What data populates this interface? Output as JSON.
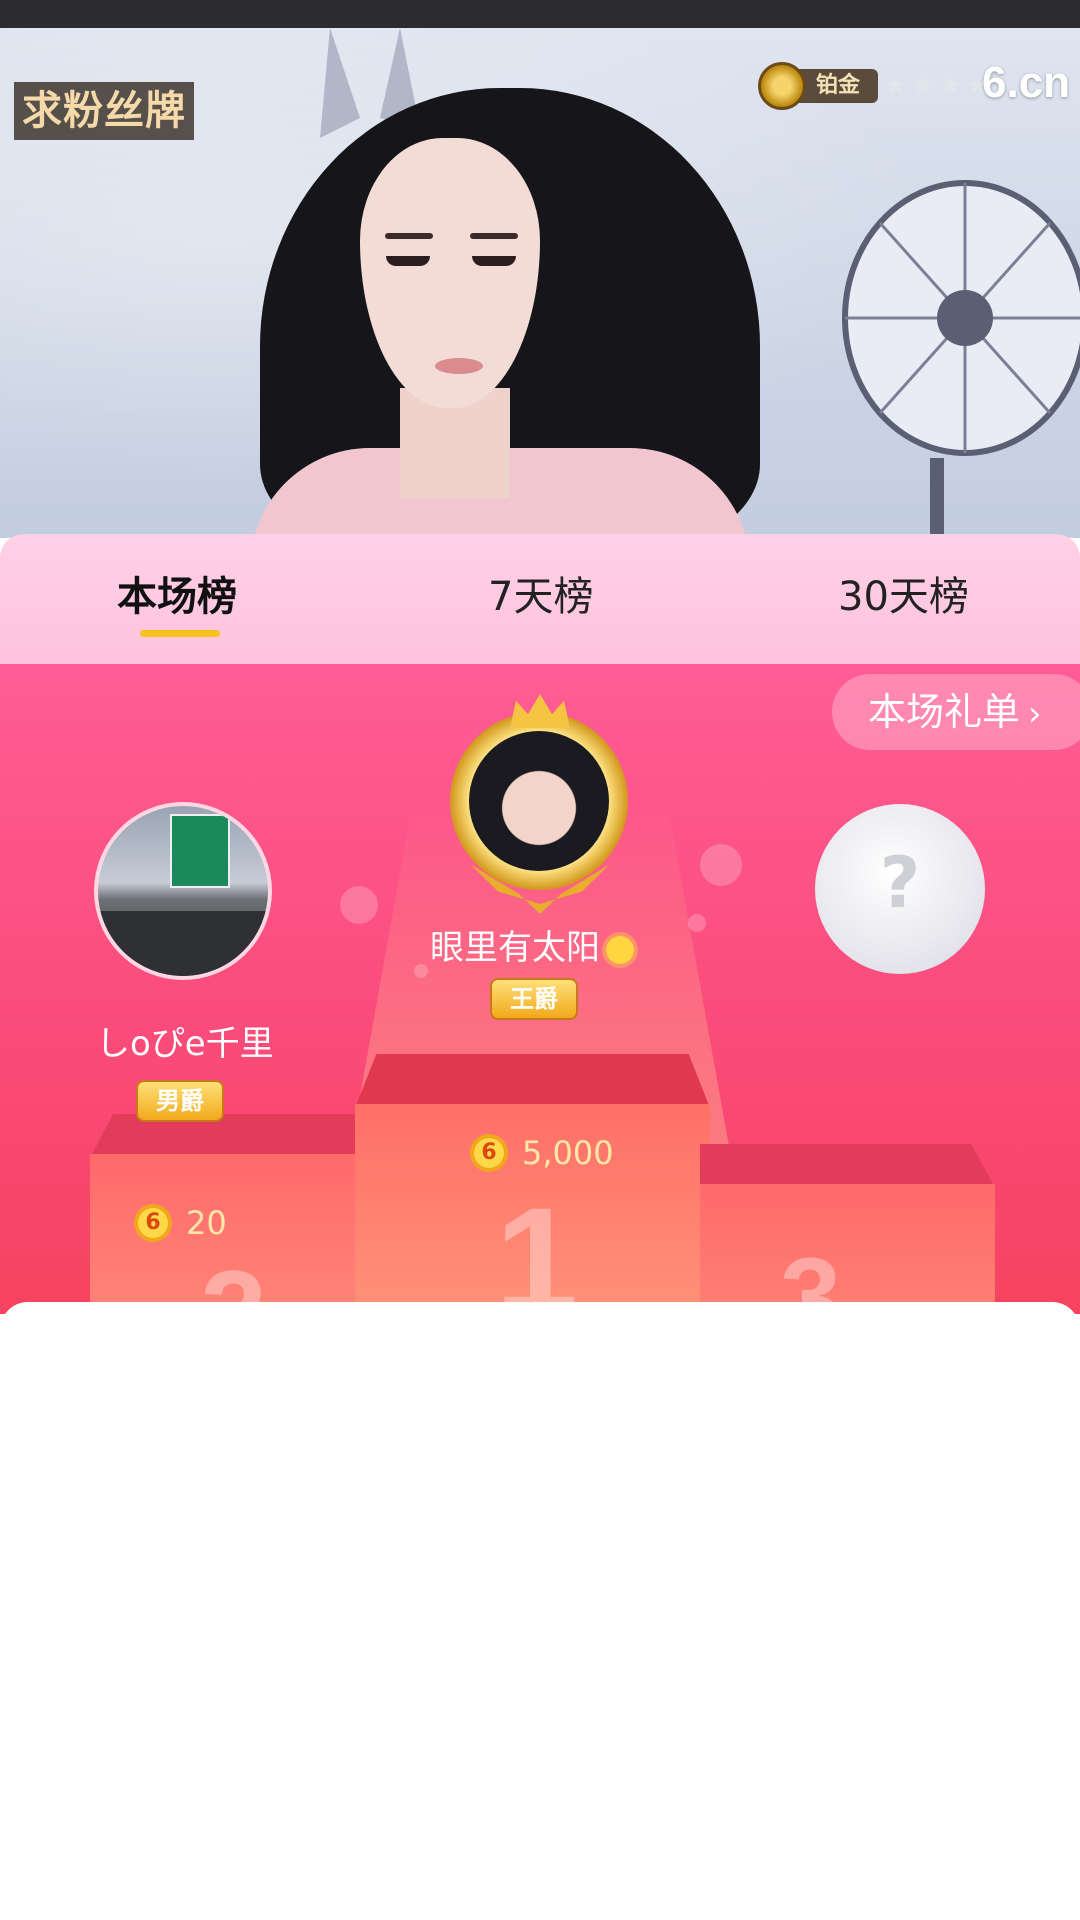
{
  "stream": {
    "fan_badge_label": "求粉丝牌",
    "level_label": "铂金",
    "level_stars": 4,
    "site_logo": "6.cn"
  },
  "tabs": [
    {
      "label": "本场榜",
      "active": true
    },
    {
      "label": "7天榜",
      "active": false
    },
    {
      "label": "30天榜",
      "active": false
    }
  ],
  "gift_list_button": {
    "label": "本场礼单",
    "chevron": "›"
  },
  "podium": {
    "first": {
      "name": "眼里有太阳",
      "name_icon": "sun-icon",
      "title": "王爵",
      "coins": "5,000",
      "coin_symbol": "6",
      "rank": "1"
    },
    "second": {
      "name": "しoぴe千里",
      "title": "男爵",
      "coins": "20",
      "coin_symbol": "6",
      "rank": "2"
    },
    "third": {
      "placeholder": "?",
      "rank": "3"
    }
  },
  "colors": {
    "tab_bg": "#ffc7e0",
    "podium_bg": "#fa4a78",
    "accent_underline": "#f7c21c",
    "coin": "#ffd84a"
  }
}
